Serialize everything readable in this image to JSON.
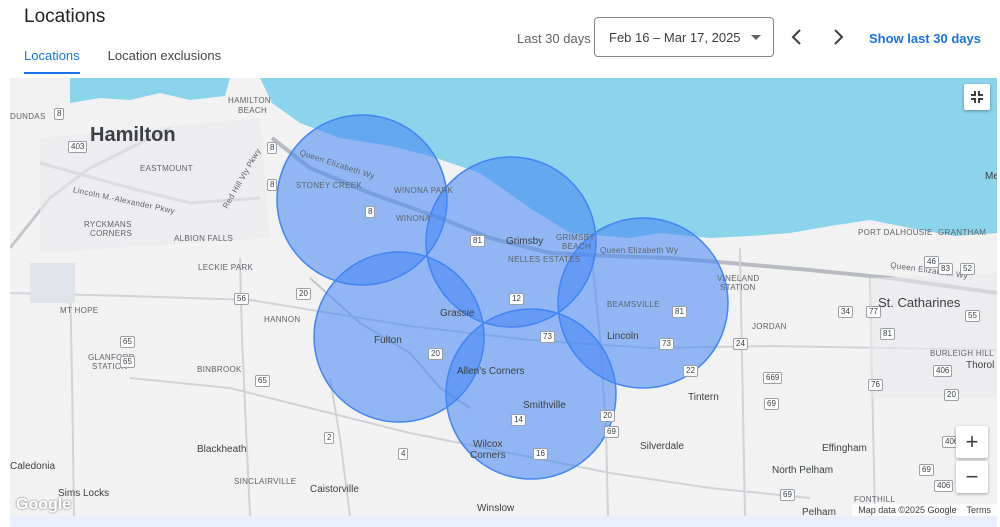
{
  "header": {
    "title": "Locations",
    "tabs": [
      {
        "label": "Locations",
        "active": true
      },
      {
        "label": "Location exclusions",
        "active": false
      }
    ],
    "range_label": "Last 30 days",
    "date_range": "Feb 16 – Mar 17, 2025",
    "show_last_label": "Show last 30 days",
    "accent_color": "#1a73e8"
  },
  "map": {
    "water_color": "#8ad4ec",
    "circle_color": "#4285f4",
    "labels": {
      "hamilton": "Hamilton",
      "hamilton_beach": "HAMILTON",
      "hamilton_beach2": "BEACH",
      "dundas": "DUNDAS",
      "eastmount": "EASTMOUNT",
      "stoney_creek": "STONEY CREEK",
      "winona_park": "WINONA PARK",
      "winona": "WINONA",
      "rymal": "RYCKMANS",
      "corners": "CORNERS",
      "albion_falls": "ALBION FALLS",
      "leckie_park": "LECKIE PARK",
      "mt_hope": "MT HOPE",
      "hannon": "HANNON",
      "glanford": "GLANFORD",
      "station": "STATION",
      "binbrook": "BINBROOK",
      "caledonia": "Caledonia",
      "blackheath": "Blackheath",
      "sinclairville": "SINCLAIRVILLE",
      "caistorville": "Caistorville",
      "sims_locks": "Sims Locks",
      "grimsby": "Grimsby",
      "grimsby_beach": "GRIMSBY",
      "grimsby_beach2": "BEACH",
      "nelles_estates": "NELLES ESTATES",
      "grassie": "Grassie",
      "fulton": "Fulton",
      "allens_corners": "Allen's Corners",
      "smithville": "Smithville",
      "wilcox": "Wilcox",
      "wilcox2": "Corners",
      "beamsville": "BEAMSVILLE",
      "lincoln": "Lincoln",
      "vineland": "VINELAND",
      "vineland2": "STATION",
      "jordan": "JORDAN",
      "tintern": "Tintern",
      "silverdale": "Silverdale",
      "effingham": "Effingham",
      "north_pelham": "North Pelham",
      "winslow": "Winslow",
      "pelham": "Pelham",
      "st_catharines": "St. Catharines",
      "port_dalhousie": "PORT DALHOUSIE",
      "grantham": "GRANTHAM",
      "burleigh_hill": "BURLEIGH HILL",
      "thorold": "Thorol",
      "fonthill": "FONTHILL",
      "qew": "Queen Elizabeth Wy",
      "lincoln_alex": "Lincoln M.-Alexander Pkwy",
      "red_hill": "Red Hill Vly Pkwy",
      "me": "Me"
    },
    "shields": [
      "8",
      "403",
      "8",
      "8",
      "8",
      "81",
      "12",
      "73",
      "20",
      "20",
      "56",
      "65",
      "65",
      "2",
      "65",
      "14",
      "16",
      "69",
      "20",
      "73",
      "22",
      "24",
      "81",
      "669",
      "69",
      "76",
      "34",
      "77",
      "81",
      "406",
      "406",
      "46",
      "83",
      "52",
      "55",
      "69",
      "20",
      "69",
      "406",
      "4"
    ],
    "zoom_in": "+",
    "zoom_out": "−",
    "logo_text": "Google",
    "attribution": "Map data ©2025 Google",
    "terms": "Terms",
    "icons": [
      "chevron-left-icon",
      "chevron-right-icon",
      "dropdown-caret-icon",
      "fullscreen-exit-icon"
    ]
  }
}
